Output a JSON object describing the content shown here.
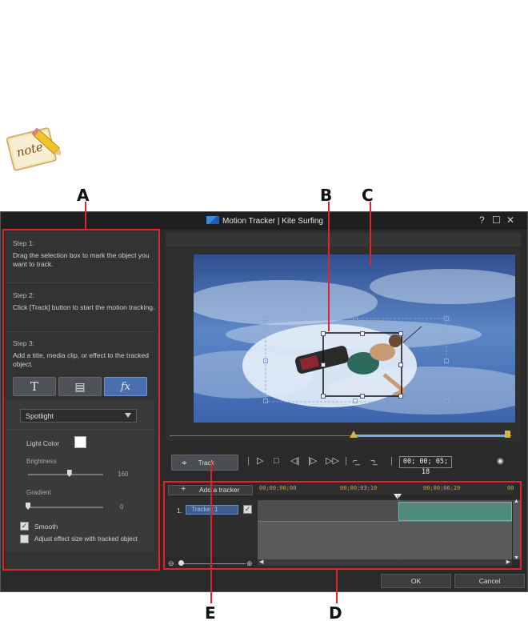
{
  "callouts": {
    "a": "A",
    "b": "B",
    "c": "C",
    "d": "D",
    "e": "E"
  },
  "app": {
    "title": "Motion Tracker | Kite Surfing",
    "help": "?",
    "maximize": "☐",
    "close": "✕"
  },
  "steps": [
    {
      "title": "Step 1:",
      "text": "Drag the selection box to mark the object you want to track."
    },
    {
      "title": "Step 2:",
      "text": "Click [Track] button to start the motion tracking."
    },
    {
      "title": "Step 3:",
      "text": "Add a title, media clip, or effect to the tracked object."
    }
  ],
  "tools": {
    "title_btn": "T",
    "media_btn": "▤",
    "effect_btn": "fx"
  },
  "effect": {
    "selected": "Spotlight",
    "light_color_label": "Light Color",
    "light_color": "#ffffff",
    "brightness_label": "Brightness",
    "brightness_value": "160",
    "brightness_fraction": 0.55,
    "gradient_label": "Gradient",
    "gradient_value": "0",
    "gradient_fraction": 0.0,
    "smooth_label": "Smooth",
    "smooth_checked": true,
    "adjust_label": "Adjust effect size with tracked object",
    "adjust_checked": false
  },
  "controls": {
    "track_label": "Track",
    "timecode": "00; 00; 05; 18"
  },
  "tracker": {
    "add_label": "Add a tracker",
    "ruler": [
      "00;00;00;00",
      "00;00;03;10",
      "00;00;06;20",
      "00"
    ],
    "rows": [
      {
        "index": "1.",
        "name": "Tracker 1",
        "checked": true
      }
    ]
  },
  "footer": {
    "ok": "OK",
    "cancel": "Cancel"
  },
  "colors": {
    "callout_red": "#e0242a",
    "accent_blue": "#4a6fae",
    "clip_green": "#4f8a7a"
  }
}
